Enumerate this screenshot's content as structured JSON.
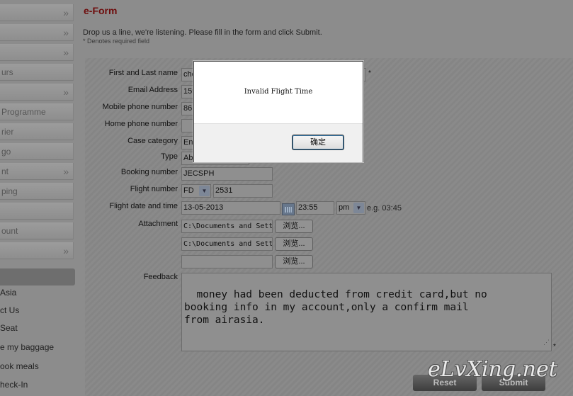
{
  "sidebar": {
    "items": [
      {
        "label": "",
        "chevron": "»"
      },
      {
        "label": "",
        "chevron": "»"
      },
      {
        "label": "",
        "chevron": "»"
      },
      {
        "label": "urs",
        "chevron": ""
      },
      {
        "label": "",
        "chevron": "»"
      },
      {
        "label": " Programme",
        "chevron": ""
      },
      {
        "label": "rier",
        "chevron": ""
      },
      {
        "label": "go",
        "chevron": ""
      },
      {
        "label": "nt",
        "chevron": "»"
      },
      {
        "label": "ping",
        "chevron": ""
      },
      {
        "label": "",
        "chevron": ""
      },
      {
        "label": "ount",
        "chevron": ""
      },
      {
        "label": "",
        "chevron": "»"
      }
    ],
    "links": [
      "Asia",
      "ct Us",
      "Seat",
      "e my baggage",
      "ook meals",
      "heck-In"
    ]
  },
  "page": {
    "title": "e-Form",
    "intro": "Drop us a line, we're listening. Please fill in the form and click Submit.",
    "required_note": "* Denotes required field"
  },
  "form": {
    "labels": {
      "name": "First and Last name",
      "email": "Email Address",
      "mobile": "Mobile phone number",
      "home": "Home phone number",
      "case": "Case category",
      "type": "Type",
      "booking": "Booking number",
      "flight": "Flight number",
      "date": "Flight date and time",
      "attachment": "Attachment",
      "feedback": "Feedback"
    },
    "values": {
      "name": "che",
      "email": "159",
      "mobile": "861",
      "home": "",
      "case": "Eng",
      "type": "Ab",
      "booking": "JECSPH",
      "flight_prefix": "FD",
      "flight_no": "2531",
      "date": "13-05-2013",
      "time": "23:55",
      "ampm": "pm",
      "file1": "C:\\Documents and Sett",
      "file2": "C:\\Documents and Sett",
      "file3": "",
      "feedback": "money had been deducted from credit card,but no\nbooking info in my account,only a confirm mail\nfrom airasia."
    },
    "time_hint": "e.g. 03:45",
    "browse_label": "浏览...",
    "required_mark": "*",
    "reset_label": "Reset",
    "submit_label": "Submit"
  },
  "dialog": {
    "message": "Invalid Flight Time",
    "ok_label": "确定"
  },
  "watermark": "eLvXing.net",
  "colors": {
    "title": "#6e0d0d",
    "overlay_bg": "#8c8c8c",
    "dialog_bg": "#ffffff"
  }
}
